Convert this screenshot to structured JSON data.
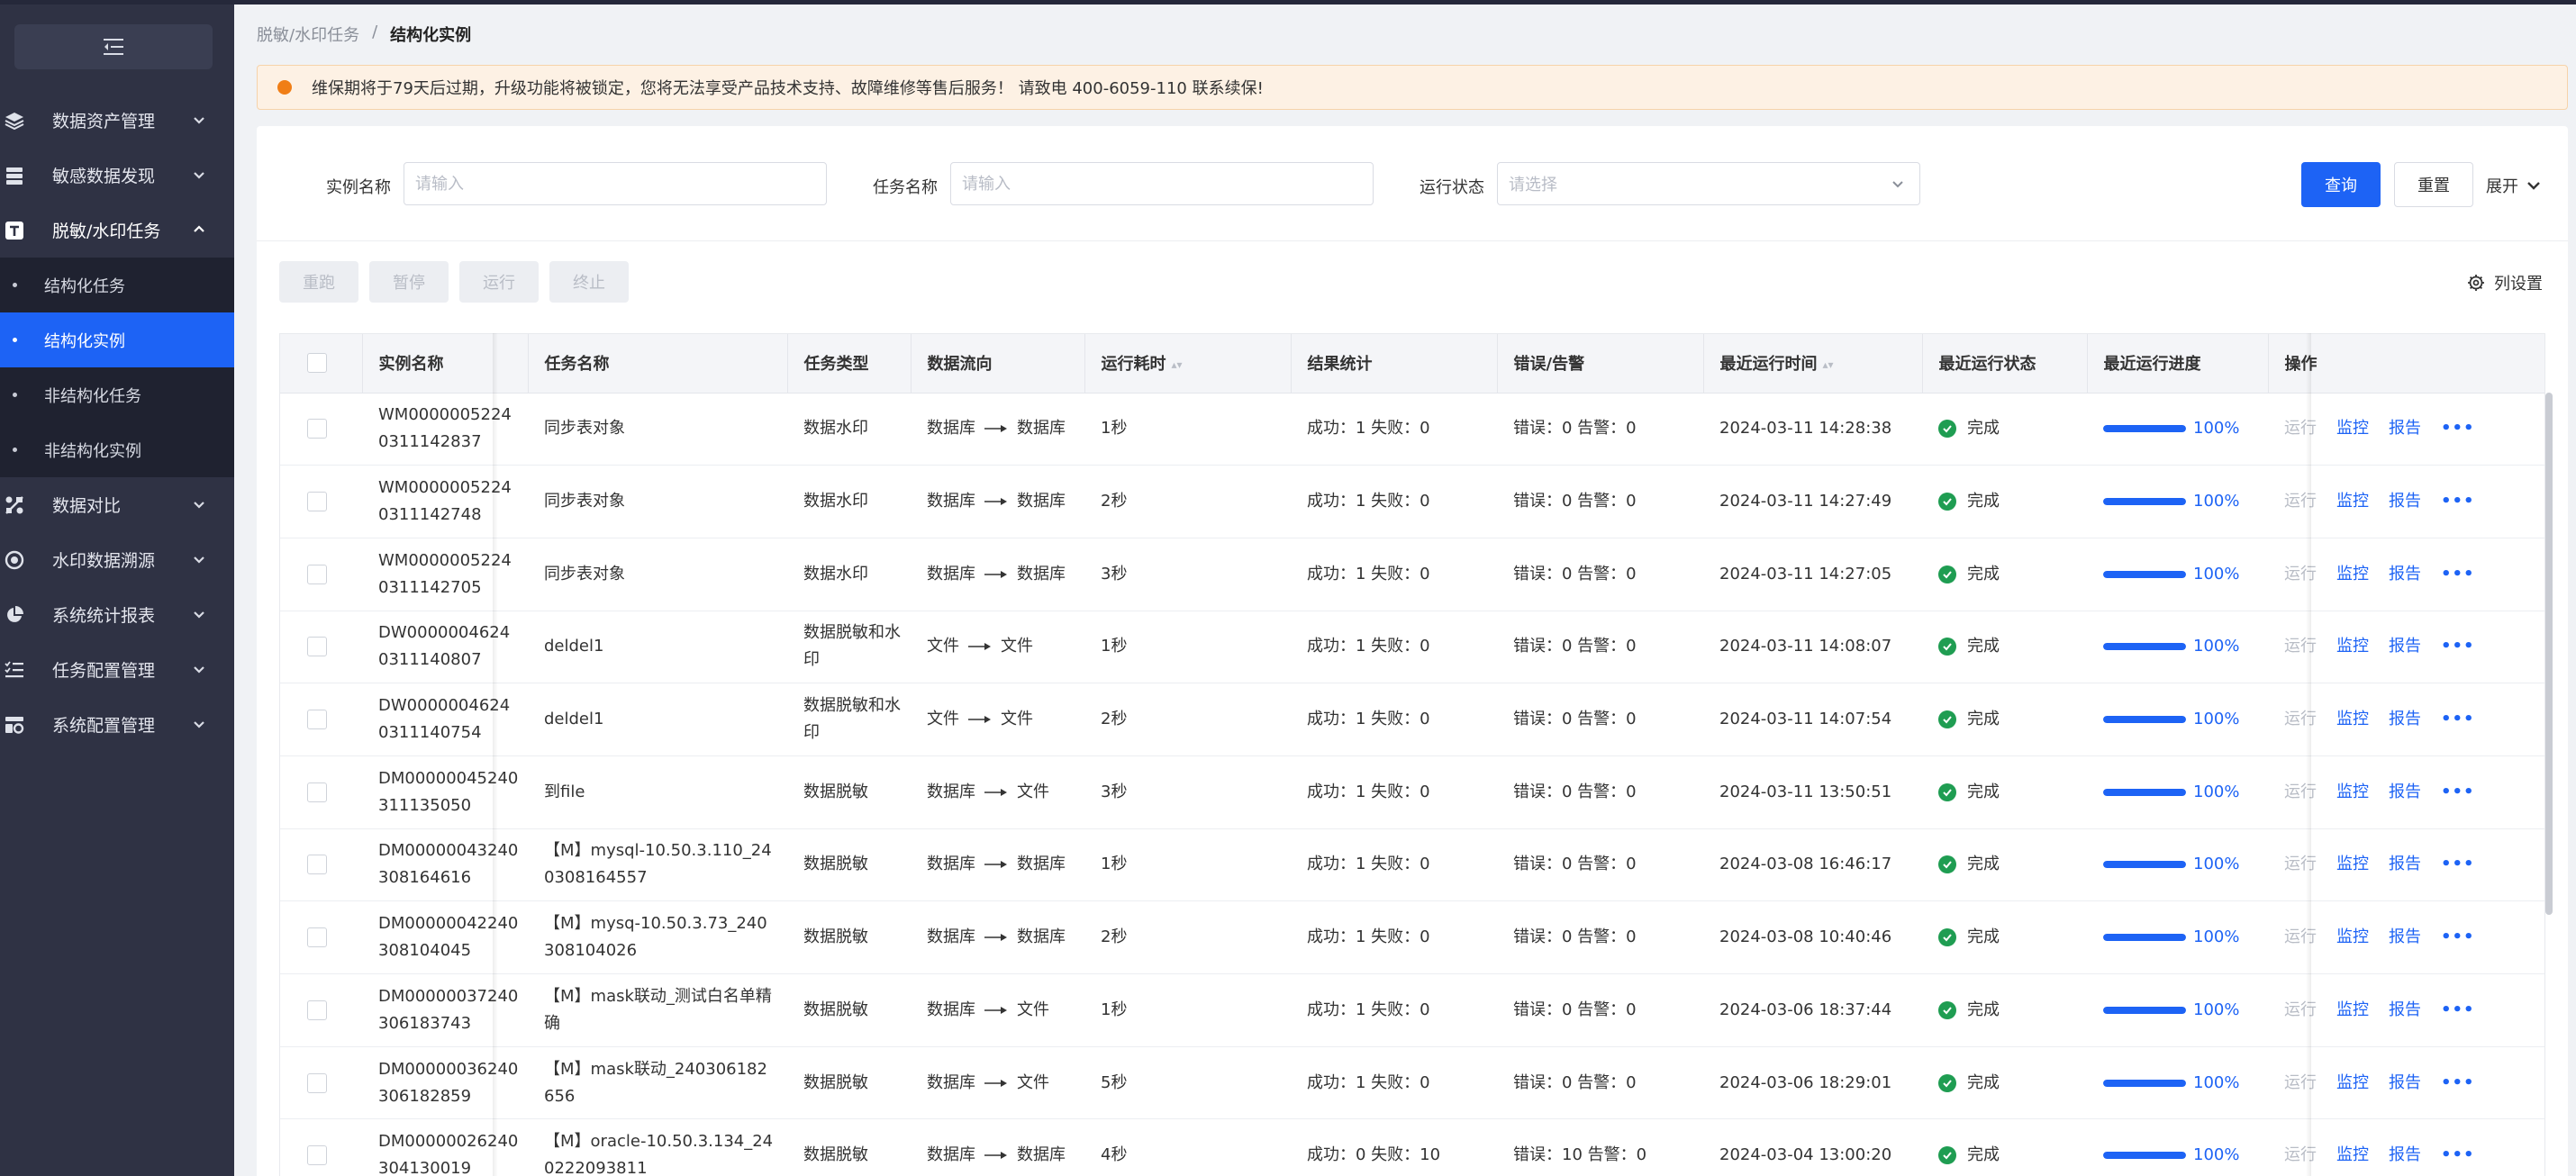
{
  "sidebar": {
    "items": [
      {
        "label": "数据资产管理",
        "icon": "layers-icon"
      },
      {
        "label": "敏感数据发现",
        "icon": "database-icon"
      },
      {
        "label": "脱敏/水印任务",
        "icon": "text-box-icon",
        "open": true,
        "children": [
          {
            "label": "结构化任务"
          },
          {
            "label": "结构化实例",
            "active": true
          },
          {
            "label": "非结构化任务"
          },
          {
            "label": "非结构化实例"
          }
        ]
      },
      {
        "label": "数据对比",
        "icon": "compare-icon"
      },
      {
        "label": "水印数据溯源",
        "icon": "target-icon"
      },
      {
        "label": "系统统计报表",
        "icon": "pie-chart-icon"
      },
      {
        "label": "任务配置管理",
        "icon": "task-list-icon"
      },
      {
        "label": "系统配置管理",
        "icon": "settings-grid-icon"
      }
    ]
  },
  "breadcrumb": {
    "parent": "脱敏/水印任务",
    "sep": "/",
    "current": "结构化实例"
  },
  "notice": {
    "text": "维保期将于79天后过期，升级功能将被锁定，您将无法享受产品技术支持、故障维修等售后服务！ 请致电 400-6059-110 联系续保!"
  },
  "filters": {
    "instance_label": "实例名称",
    "instance_placeholder": "请输入",
    "task_label": "任务名称",
    "task_placeholder": "请输入",
    "status_label": "运行状态",
    "status_placeholder": "请选择",
    "query_label": "查询",
    "reset_label": "重置",
    "expand_label": "展开"
  },
  "actions": {
    "rerun": "重跑",
    "pause": "暂停",
    "run": "运行",
    "stop": "终止",
    "column_settings": "列设置"
  },
  "table": {
    "headers": [
      "实例名称",
      "任务名称",
      "任务类型",
      "数据流向",
      "运行耗时",
      "结果统计",
      "错误/告警",
      "最近运行时间",
      "最近运行状态",
      "最近运行进度",
      "操作"
    ],
    "ops": {
      "run": "运行",
      "monitor": "监控",
      "report": "报告",
      "more": "•••"
    },
    "rows": [
      {
        "id": "WM00000052240311142837",
        "task": "同步表对象",
        "type": "数据水印",
        "flow_from": "数据库",
        "flow_to": "数据库",
        "duration": "1秒",
        "result": "成功：1 失败：0",
        "errors": "错误：0 告警：0",
        "time": "2024-03-11 14:28:38",
        "status": "完成",
        "progress": "100%"
      },
      {
        "id": "WM00000052240311142748",
        "task": "同步表对象",
        "type": "数据水印",
        "flow_from": "数据库",
        "flow_to": "数据库",
        "duration": "2秒",
        "result": "成功：1 失败：0",
        "errors": "错误：0 告警：0",
        "time": "2024-03-11 14:27:49",
        "status": "完成",
        "progress": "100%"
      },
      {
        "id": "WM00000052240311142705",
        "task": "同步表对象",
        "type": "数据水印",
        "flow_from": "数据库",
        "flow_to": "数据库",
        "duration": "3秒",
        "result": "成功：1 失败：0",
        "errors": "错误：0 告警：0",
        "time": "2024-03-11 14:27:05",
        "status": "完成",
        "progress": "100%"
      },
      {
        "id": "DW00000046240311140807",
        "task": "deldel1",
        "type": "数据脱敏和水印",
        "flow_from": "文件",
        "flow_to": "文件",
        "duration": "1秒",
        "result": "成功：1 失败：0",
        "errors": "错误：0 告警：0",
        "time": "2024-03-11 14:08:07",
        "status": "完成",
        "progress": "100%"
      },
      {
        "id": "DW00000046240311140754",
        "task": "deldel1",
        "type": "数据脱敏和水印",
        "flow_from": "文件",
        "flow_to": "文件",
        "duration": "2秒",
        "result": "成功：1 失败：0",
        "errors": "错误：0 告警：0",
        "time": "2024-03-11 14:07:54",
        "status": "完成",
        "progress": "100%"
      },
      {
        "id": "DM00000045240311135050",
        "task": "到file",
        "type": "数据脱敏",
        "flow_from": "数据库",
        "flow_to": "文件",
        "duration": "3秒",
        "result": "成功：1 失败：0",
        "errors": "错误：0 告警：0",
        "time": "2024-03-11 13:50:51",
        "status": "完成",
        "progress": "100%"
      },
      {
        "id": "DM00000043240308164616",
        "task": "【M】mysql-10.50.3.110_240308164557",
        "type": "数据脱敏",
        "flow_from": "数据库",
        "flow_to": "数据库",
        "duration": "1秒",
        "result": "成功：1 失败：0",
        "errors": "错误：0 告警：0",
        "time": "2024-03-08 16:46:17",
        "status": "完成",
        "progress": "100%"
      },
      {
        "id": "DM00000042240308104045",
        "task": "【M】mysq-10.50.3.73_240308104026",
        "type": "数据脱敏",
        "flow_from": "数据库",
        "flow_to": "数据库",
        "duration": "2秒",
        "result": "成功：1 失败：0",
        "errors": "错误：0 告警：0",
        "time": "2024-03-08 10:40:46",
        "status": "完成",
        "progress": "100%"
      },
      {
        "id": "DM00000037240306183743",
        "task": "【M】mask联动_测试白名单精确",
        "type": "数据脱敏",
        "flow_from": "数据库",
        "flow_to": "文件",
        "duration": "1秒",
        "result": "成功：1 失败：0",
        "errors": "错误：0 告警：0",
        "time": "2024-03-06 18:37:44",
        "status": "完成",
        "progress": "100%"
      },
      {
        "id": "DM00000036240306182859",
        "task": "【M】mask联动_240306182656",
        "type": "数据脱敏",
        "flow_from": "数据库",
        "flow_to": "文件",
        "duration": "5秒",
        "result": "成功：1 失败：0",
        "errors": "错误：0 告警：0",
        "time": "2024-03-06 18:29:01",
        "status": "完成",
        "progress": "100%"
      },
      {
        "id": "DM00000026240304130019",
        "task": "【M】oracle-10.50.3.134_240222093811",
        "type": "数据脱敏",
        "flow_from": "数据库",
        "flow_to": "数据库",
        "duration": "4秒",
        "result": "成功：0 失败：10",
        "errors": "错误：10 告警：0",
        "time": "2024-03-04 13:00:20",
        "status": "完成",
        "progress": "100%"
      }
    ]
  },
  "colors": {
    "primary": "#1d63f5",
    "sidebar_bg": "#2f3244",
    "success": "#1f9d52",
    "notice_bg": "#fdf1e4",
    "notice_dot": "#f07e16"
  }
}
